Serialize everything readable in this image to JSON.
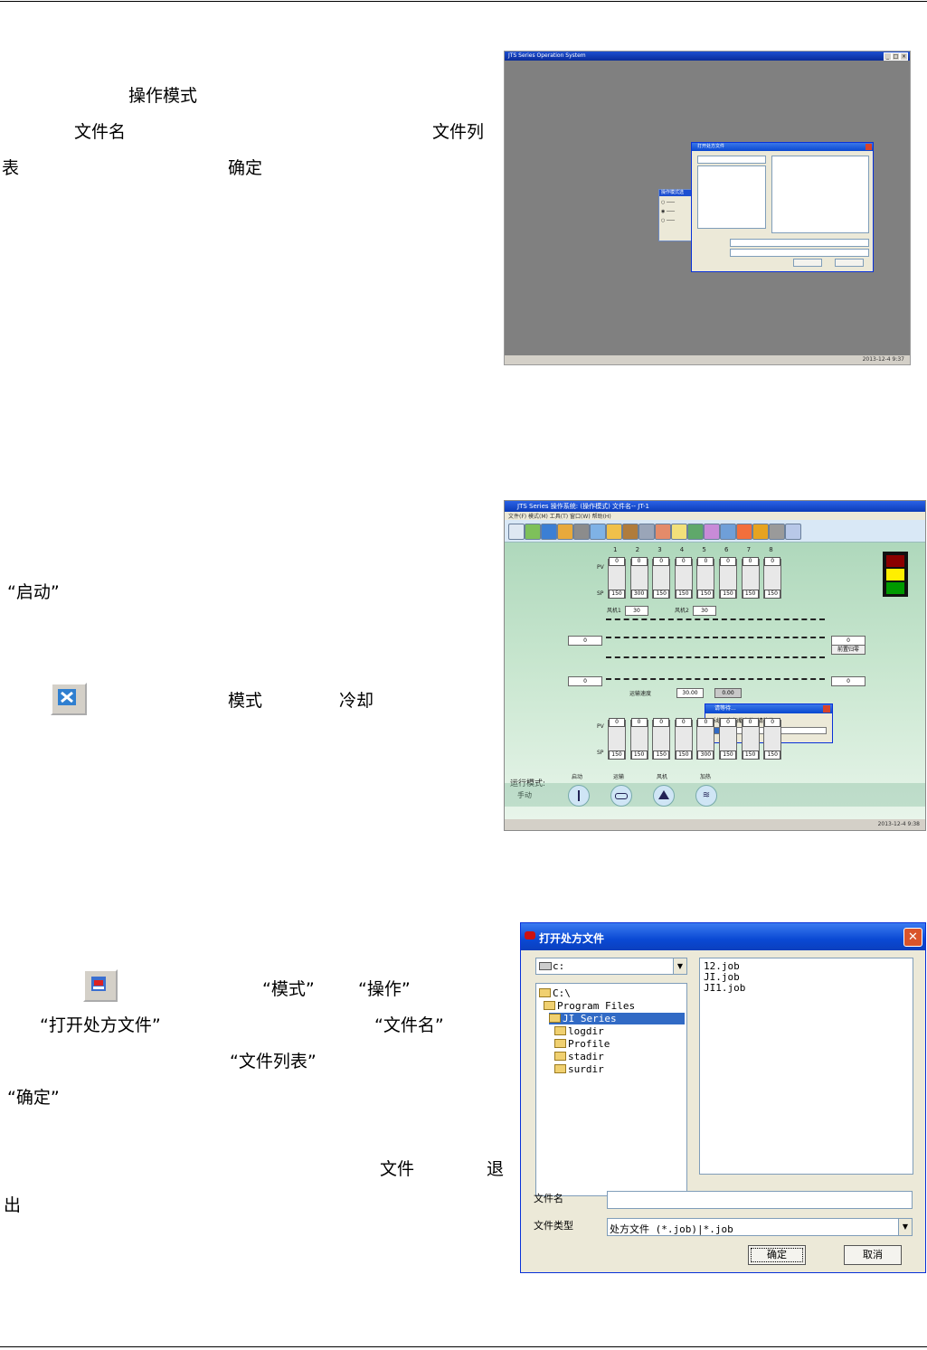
{
  "section1": {
    "text1": "操作模式",
    "text2": "文件名",
    "text3": "文件列",
    "text4": "表",
    "text5": "确定"
  },
  "section2": {
    "text1": "“启动”",
    "text2": "模式",
    "text3": "冷却"
  },
  "section3": {
    "text1": "“模式”",
    "text2": "“操作”",
    "text3": "“打开处方文件”",
    "text4": "“文件名”",
    "text5": "“文件列表”",
    "text6": "“确定”",
    "text7": "文件",
    "text8": "退",
    "text9": "出"
  },
  "shot1": {
    "title": "JTS Series Operation System",
    "dialog_title": "打开处方文件",
    "mode_title": "操作模式选",
    "status": "2013-12-4  9:37"
  },
  "shot2": {
    "title": "JTS Series 操作系统: (操作模式) 文件名-- JT-1",
    "menu": "文件(F)   模式(M)   工具(T)   窗口(W)   帮助(H)",
    "zones": [
      "1",
      "2",
      "3",
      "4",
      "5",
      "6",
      "7",
      "8"
    ],
    "top_pv": [
      "0",
      "0",
      "0",
      "0",
      "0",
      "0",
      "0",
      "0"
    ],
    "top_sp": [
      "150",
      "300",
      "150",
      "150",
      "150",
      "150",
      "150",
      "150"
    ],
    "bot_pv": [
      "0",
      "0",
      "0",
      "0",
      "0",
      "0",
      "0",
      "0"
    ],
    "bot_sp": [
      "150",
      "150",
      "150",
      "150",
      "300",
      "150",
      "150",
      "150"
    ],
    "fan1_label": "风机1",
    "fan1_value": "30",
    "fan2_label": "风机2",
    "fan2_value": "30",
    "left_top": "0",
    "right_top": "0",
    "reset_btn": "前置归零",
    "left_bot": "0",
    "right_bot": "0",
    "speed_label": "运输速度",
    "speed_set": "30.00",
    "speed_act": "0.00",
    "wait_title": "请等待...",
    "wait_msg": "系统正在加载文件, 请等待...",
    "run_mode_label": "运行模式:",
    "run_mode_value": "手动",
    "btn_labels": [
      "启动",
      "运输",
      "风机",
      "加热"
    ],
    "status": "2013-12-4  9:38",
    "pv_label": "PV",
    "sp_label": "SP"
  },
  "shot3": {
    "title": "打开处方文件",
    "drive": "c:",
    "dirs": [
      "C:\\",
      "Program Files",
      "JI Series",
      "logdir",
      "Profile",
      "stadir",
      "surdir"
    ],
    "files": [
      "12.job",
      "JI.job",
      "JI1.job"
    ],
    "name_label": "文件名",
    "name_value": "",
    "type_label": "文件类型",
    "type_value": "处方文件 (*.job)|*.job",
    "ok": "确定",
    "cancel": "取消"
  }
}
